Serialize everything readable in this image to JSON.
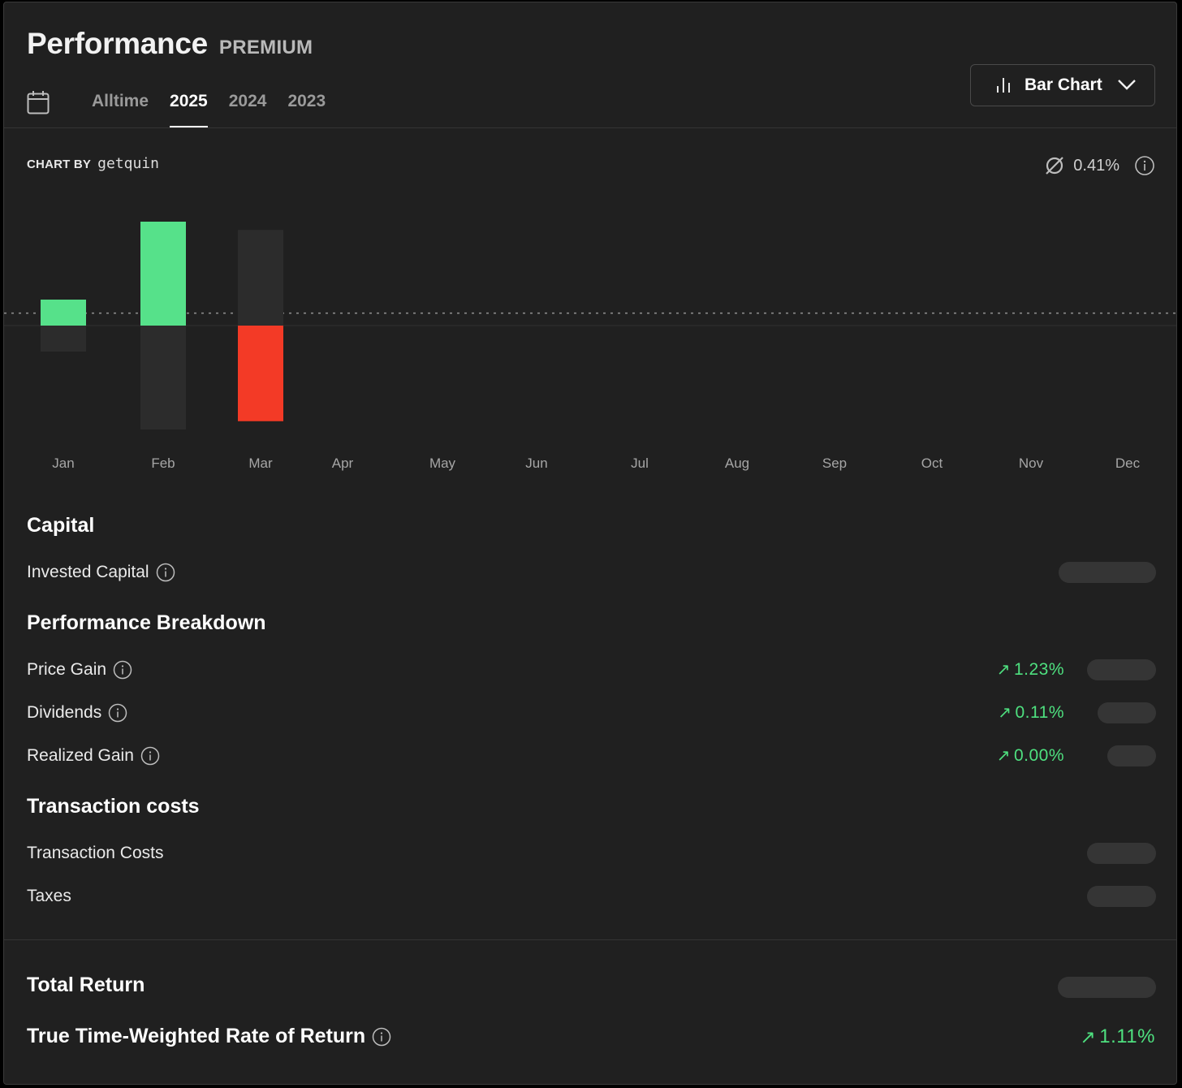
{
  "header": {
    "title": "Performance",
    "badge": "PREMIUM"
  },
  "tabs": [
    {
      "label": "Alltime",
      "active": false
    },
    {
      "label": "2025",
      "active": true
    },
    {
      "label": "2024",
      "active": false
    },
    {
      "label": "2023",
      "active": false
    }
  ],
  "chart_selector": {
    "label": "Bar Chart",
    "icon": "bar-chart-icon"
  },
  "chart_by": {
    "label": "CHART BY",
    "brand": "getquin"
  },
  "average": {
    "value": "0.41%",
    "icon": "average-icon"
  },
  "colors": {
    "positive": "#56e18a",
    "negative": "#f33a26",
    "range": "#2c2c2c",
    "text_positive": "#4ee07f"
  },
  "chart_data": {
    "type": "bar",
    "categories": [
      "Jan",
      "Feb",
      "Mar",
      "Apr",
      "May",
      "Jun",
      "Jul",
      "Aug",
      "Sep",
      "Oct",
      "Nov",
      "Dec"
    ],
    "values": [
      0.25,
      1.0,
      -0.92,
      null,
      null,
      null,
      null,
      null,
      null,
      null,
      null,
      null
    ],
    "range_min": [
      -0.25,
      -1.0,
      null,
      null,
      null,
      null,
      null,
      null,
      null,
      null,
      null,
      null
    ],
    "range_max": [
      null,
      null,
      0.92,
      null,
      null,
      null,
      null,
      null,
      null,
      null,
      null,
      null
    ],
    "average_line": 0.12,
    "ylim": [
      -1.1,
      1.1
    ],
    "xlabel": "",
    "ylabel": "",
    "grid": false
  },
  "capital": {
    "title": "Capital",
    "rows": [
      {
        "label": "Invested Capital"
      }
    ]
  },
  "breakdown": {
    "title": "Performance Breakdown",
    "rows": [
      {
        "label": "Price Gain",
        "value": "1.23%"
      },
      {
        "label": "Dividends",
        "value": "0.11%"
      },
      {
        "label": "Realized Gain",
        "value": "0.00%"
      }
    ]
  },
  "transaction": {
    "title": "Transaction costs",
    "rows": [
      {
        "label": "Transaction Costs"
      },
      {
        "label": "Taxes"
      }
    ]
  },
  "total": {
    "total_return_label": "Total Return",
    "ttwror_label": "True Time-Weighted Rate of Return",
    "ttwror_value": "1.11%"
  },
  "arrow_glyph": "↗"
}
